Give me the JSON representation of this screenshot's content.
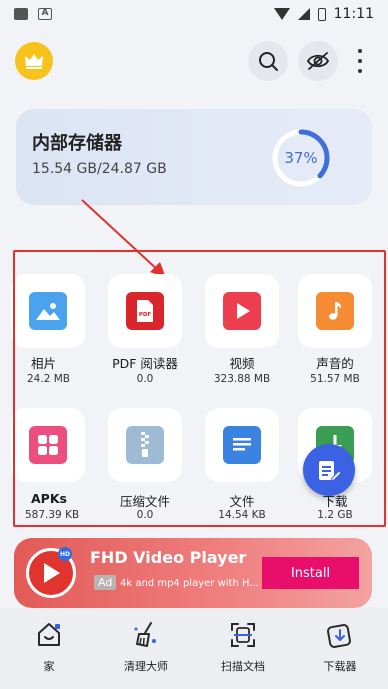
{
  "status_bar": {
    "time": "11:11"
  },
  "storage": {
    "title": "内部存储器",
    "size": "15.54 GB/24.87 GB",
    "percent_label": "37%",
    "percent": 37
  },
  "categories": [
    {
      "label": "相片",
      "size": "24.2 MB",
      "icon": "image-icon",
      "color": "#4aa3ec"
    },
    {
      "label": "PDF 阅读器",
      "size": "0.0",
      "icon": "pdf-icon",
      "color": "#d9262c"
    },
    {
      "label": "视频",
      "size": "323.88 MB",
      "icon": "play-icon",
      "color": "#ec3e4e"
    },
    {
      "label": "声音的",
      "size": "51.57 MB",
      "icon": "music-icon",
      "color": "#f58c34"
    },
    {
      "label": "APKs",
      "size": "587.39 KB",
      "icon": "apps-icon",
      "color": "#ec4f7d"
    },
    {
      "label": "压缩文件",
      "size": "0.0",
      "icon": "zip-icon",
      "color": "#9fbad5"
    },
    {
      "label": "文件",
      "size": "14.54 KB",
      "icon": "document-icon",
      "color": "#3b83e0"
    },
    {
      "label": "下载",
      "size": "1.2 GB",
      "icon": "download-icon",
      "color": "#3c9e54"
    }
  ],
  "ad": {
    "title": "FHD Video Player",
    "badge": "Ad",
    "description": "4k and mp4 player with H...",
    "install": "Install",
    "logo_badge": "HD"
  },
  "nav": [
    {
      "label": "家",
      "icon": "home-icon"
    },
    {
      "label": "清理大师",
      "icon": "broom-icon"
    },
    {
      "label": "扫描文档",
      "icon": "scan-icon"
    },
    {
      "label": "下载器",
      "icon": "downloader-icon"
    }
  ]
}
